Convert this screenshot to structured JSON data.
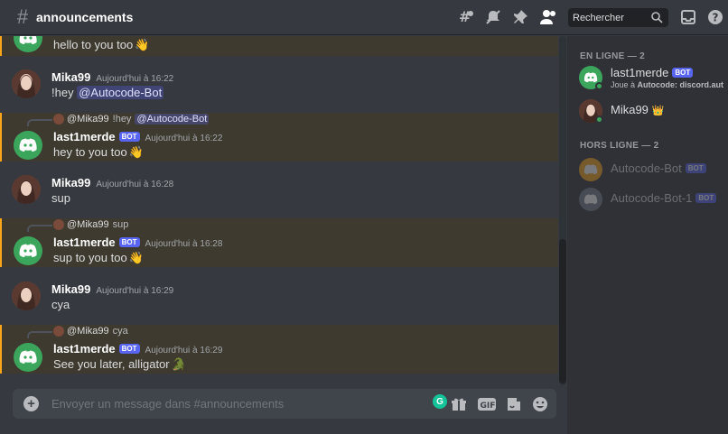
{
  "header": {
    "channel": "announcements",
    "search_placeholder": "Rechercher"
  },
  "messages": [
    {
      "author": "last1merde",
      "bot": "BOT",
      "timestamp": "Aujourd'hui à 16:22",
      "text": "hello to you too",
      "emoji": "👋",
      "reply": null
    },
    {
      "author": "Mika99",
      "timestamp": "Aujourd'hui à 16:22",
      "text": "!hey",
      "mention": "@Autocode-Bot"
    },
    {
      "author": "last1merde",
      "bot": "BOT",
      "timestamp": "Aujourd'hui à 16:22",
      "text": "hey to you too",
      "emoji": "👋",
      "reply": {
        "name": "@Mika99",
        "text": "!hey",
        "mention": "@Autocode-Bot"
      }
    },
    {
      "author": "Mika99",
      "timestamp": "Aujourd'hui à 16:28",
      "text": "sup"
    },
    {
      "author": "last1merde",
      "bot": "BOT",
      "timestamp": "Aujourd'hui à 16:28",
      "text": "sup to you too",
      "emoji": "👋",
      "reply": {
        "name": "@Mika99",
        "text": "sup"
      }
    },
    {
      "author": "Mika99",
      "timestamp": "Aujourd'hui à 16:29",
      "text": "cya"
    },
    {
      "author": "last1merde",
      "bot": "BOT",
      "timestamp": "Aujourd'hui à 16:29",
      "text": "See you later, alligator",
      "emoji": "🐊",
      "reply": {
        "name": "@Mika99",
        "text": "cya"
      }
    }
  ],
  "composer": {
    "placeholder": "Envoyer un message dans #announcements",
    "gif_label": "GIF",
    "grammarly": "G"
  },
  "members": {
    "online_header": "EN LIGNE — 2",
    "offline_header": "HORS LIGNE — 2",
    "online": [
      {
        "name": "last1merde",
        "bot": "BOT",
        "status_prefix": "Joue à ",
        "status_game": "Autocode: discord.auto..."
      },
      {
        "name": "Mika99",
        "crown": "👑"
      }
    ],
    "offline": [
      {
        "name": "Autocode-Bot",
        "bot": "BOT"
      },
      {
        "name": "Autocode-Bot-1",
        "bot": "BOT"
      }
    ]
  },
  "colors": {
    "background": "#36393f",
    "sidebar": "#2f3136",
    "highlight": "#3e3a30",
    "highlight_border": "#faa61a",
    "bot_badge": "#5865f2",
    "online": "#3ba55c",
    "discord_green": "#3ba55c"
  },
  "icons": [
    "hash-icon",
    "threads-icon",
    "mute-icon",
    "pin-icon",
    "members-icon",
    "search-icon",
    "inbox-icon",
    "help-icon",
    "plus-icon",
    "gift-icon",
    "gif-icon",
    "sticker-icon",
    "emoji-icon"
  ]
}
